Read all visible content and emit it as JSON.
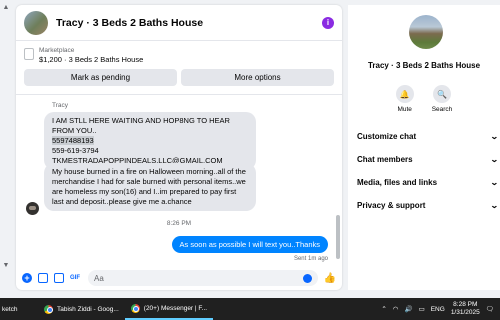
{
  "chat": {
    "title": "Tracy · 3 Beds 2 Baths House",
    "listing": {
      "category": "Marketplace",
      "price_title": "$1,200 · 3 Beds 2 Baths House",
      "mark_pending": "Mark as pending",
      "more_options": "More options"
    },
    "messages": {
      "sender": "Tracy",
      "b1_line1": "I AM STLL HERE WAITING AND HOP8NG TO HEAR FROM YOU..",
      "b1_line2": "5597488193",
      "b1_line3": "559-619-3794",
      "b1_line4": "TKMESTRADAPOPPINDEALS.LLC@GMAIL.COM",
      "b2": "My house burned in a fire on Halloween morning..all of the merchandise I had for sale burned with personal items..we are homeless my son(16) and I..im prepared to pay first last and deposit..please give me a.chance",
      "timestamp": "8:26 PM",
      "mine": "As soon as possible I will text you..Thanks",
      "sent_meta": "Sent 1m ago"
    },
    "composer_placeholder": "Aa"
  },
  "side": {
    "title": "Tracy · 3 Beds 2 Baths House",
    "mute_label": "Mute",
    "search_label": "Search",
    "items": [
      "Customize chat",
      "Chat members",
      "Media, files and links",
      "Privacy & support"
    ]
  },
  "taskbar": {
    "first": "ketch",
    "app1": "Tabish Ziddi - Goog...",
    "app2": "(20+) Messenger | F...",
    "lang": "ENG",
    "time": "8:28 PM",
    "date": "1/31/2025"
  },
  "colors": {
    "accent": "#0866ff",
    "bubble_mine": "#0084ff",
    "info": "#8a2be2"
  }
}
